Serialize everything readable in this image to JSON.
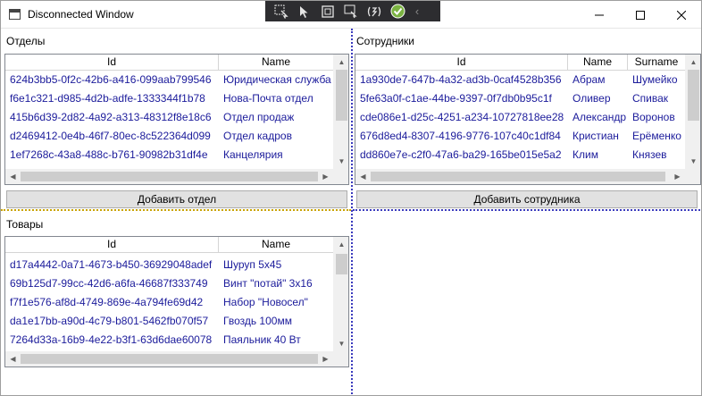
{
  "window": {
    "title": "Disconnected Window"
  },
  "devtools": {
    "icons": [
      "select-element-icon",
      "track-focus-icon",
      "display-layout-adorners-icon",
      "hot-reload-icon",
      "binding-failures-icon",
      "check-icon",
      "collapse-icon"
    ],
    "collapse_glyph": "‹",
    "check_glyph": "✓"
  },
  "caption": {
    "minimize": "—",
    "maximize": "☐",
    "close": "✕"
  },
  "departments": {
    "label": "Отделы",
    "columns": [
      "Id",
      "Name"
    ],
    "rows": [
      [
        "624b3bb5-0f2c-42b6-a416-099aab799546",
        "Юридическая служба"
      ],
      [
        "f6e1c321-d985-4d2b-adfe-1333344f1b78",
        "Нова-Почта отдел"
      ],
      [
        "415b6d39-2d82-4a92-a313-48312f8e18c6",
        "Отдел продаж"
      ],
      [
        "d2469412-0e4b-46f7-80ec-8c522364d099",
        "Отдел кадров"
      ],
      [
        "1ef7268c-43a8-488c-b761-90982b31df4e",
        "Канцелярия"
      ]
    ],
    "add_button": "Добавить отдел"
  },
  "employees": {
    "label": "Сотрудники",
    "columns": [
      "Id",
      "Name",
      "Surname"
    ],
    "rows": [
      [
        "1a930de7-647b-4a32-ad3b-0caf4528b356",
        "Абрам",
        "Шумейко"
      ],
      [
        "5fe63a0f-c1ae-44be-9397-0f7db0b95c1f",
        "Оливер",
        "Спивак"
      ],
      [
        "cde086e1-d25c-4251-a234-10727818ee28",
        "Александр",
        "Воронов"
      ],
      [
        "676d8ed4-8307-4196-9776-107c40c1df84",
        "Кристиан",
        "Ерёменко"
      ],
      [
        "dd860e7e-c2f0-47a6-ba29-165be015e5a2",
        "Клим",
        "Князев"
      ]
    ],
    "add_button": "Добавить сотрудника"
  },
  "products": {
    "label": "Товары",
    "columns": [
      "Id",
      "Name"
    ],
    "rows": [
      [
        "d17a4442-0a71-4673-b450-36929048adef",
        "Шуруп 5х45"
      ],
      [
        "69b125d7-99cc-42d6-a6fa-46687f333749",
        "Винт \"потай\" 3х16"
      ],
      [
        "f7f1e576-af8d-4749-869e-4a794fe69d42",
        "Набор \"Новосел\""
      ],
      [
        "da1e17bb-a90d-4c79-b801-5462fb070f57",
        "Гвоздь 100мм"
      ],
      [
        "7264d33a-16b9-4e22-b3f1-63d6dae60078",
        "Паяльник 40 Вт"
      ]
    ]
  },
  "scroll": {
    "up": "▲",
    "down": "▼",
    "left": "◀",
    "right": "▶"
  }
}
